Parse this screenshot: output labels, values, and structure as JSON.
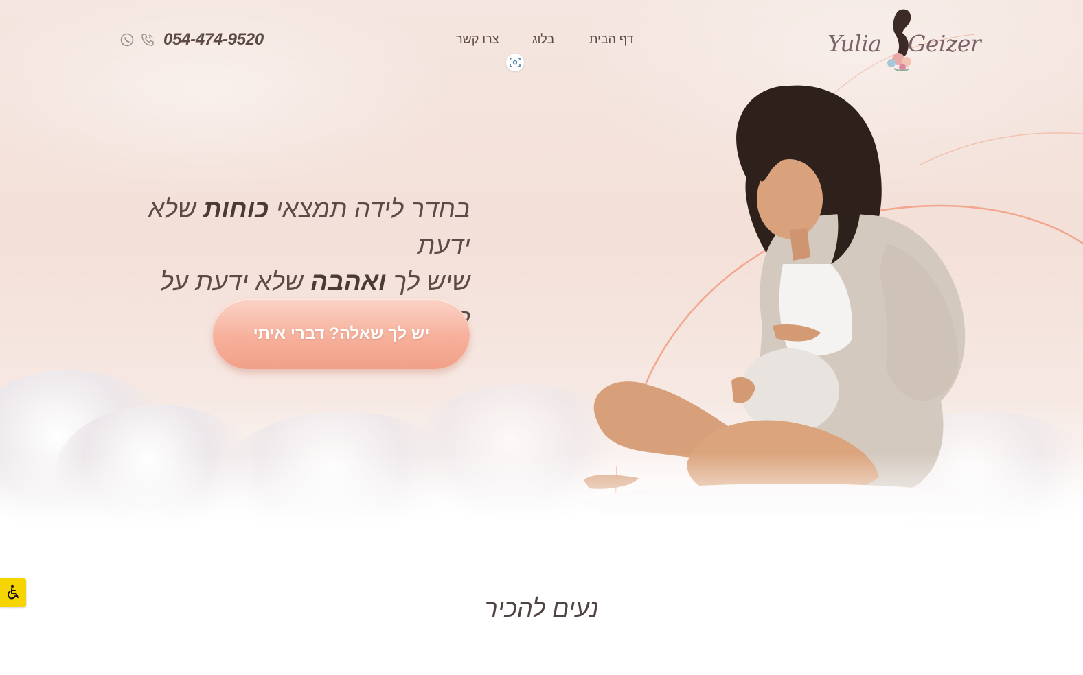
{
  "brand": {
    "logo_first": "Yulia",
    "logo_last": "Geizer"
  },
  "nav": {
    "items": [
      {
        "label": "דף הבית"
      },
      {
        "label": "בלוג"
      },
      {
        "label": "צרו קשר"
      }
    ]
  },
  "contact": {
    "phone": "054-474-9520",
    "icons": [
      "whatsapp-icon",
      "phone-icon"
    ]
  },
  "hero": {
    "line1_pre": "בחדר לידה תמצאי ",
    "line1_bold": "כוחות",
    "line1_post": " שלא ידעת",
    "line2_pre": "שיש לך ",
    "line2_bold": "ואהבה",
    "line2_post": " שלא ידעת על קיומה",
    "cta_label": "יש לך שאלה? דברי איתי"
  },
  "about": {
    "title": "נעים להכיר"
  },
  "colors": {
    "accent": "#f4a58e",
    "text": "#5c4a46",
    "accessibility": "#f6d400"
  }
}
